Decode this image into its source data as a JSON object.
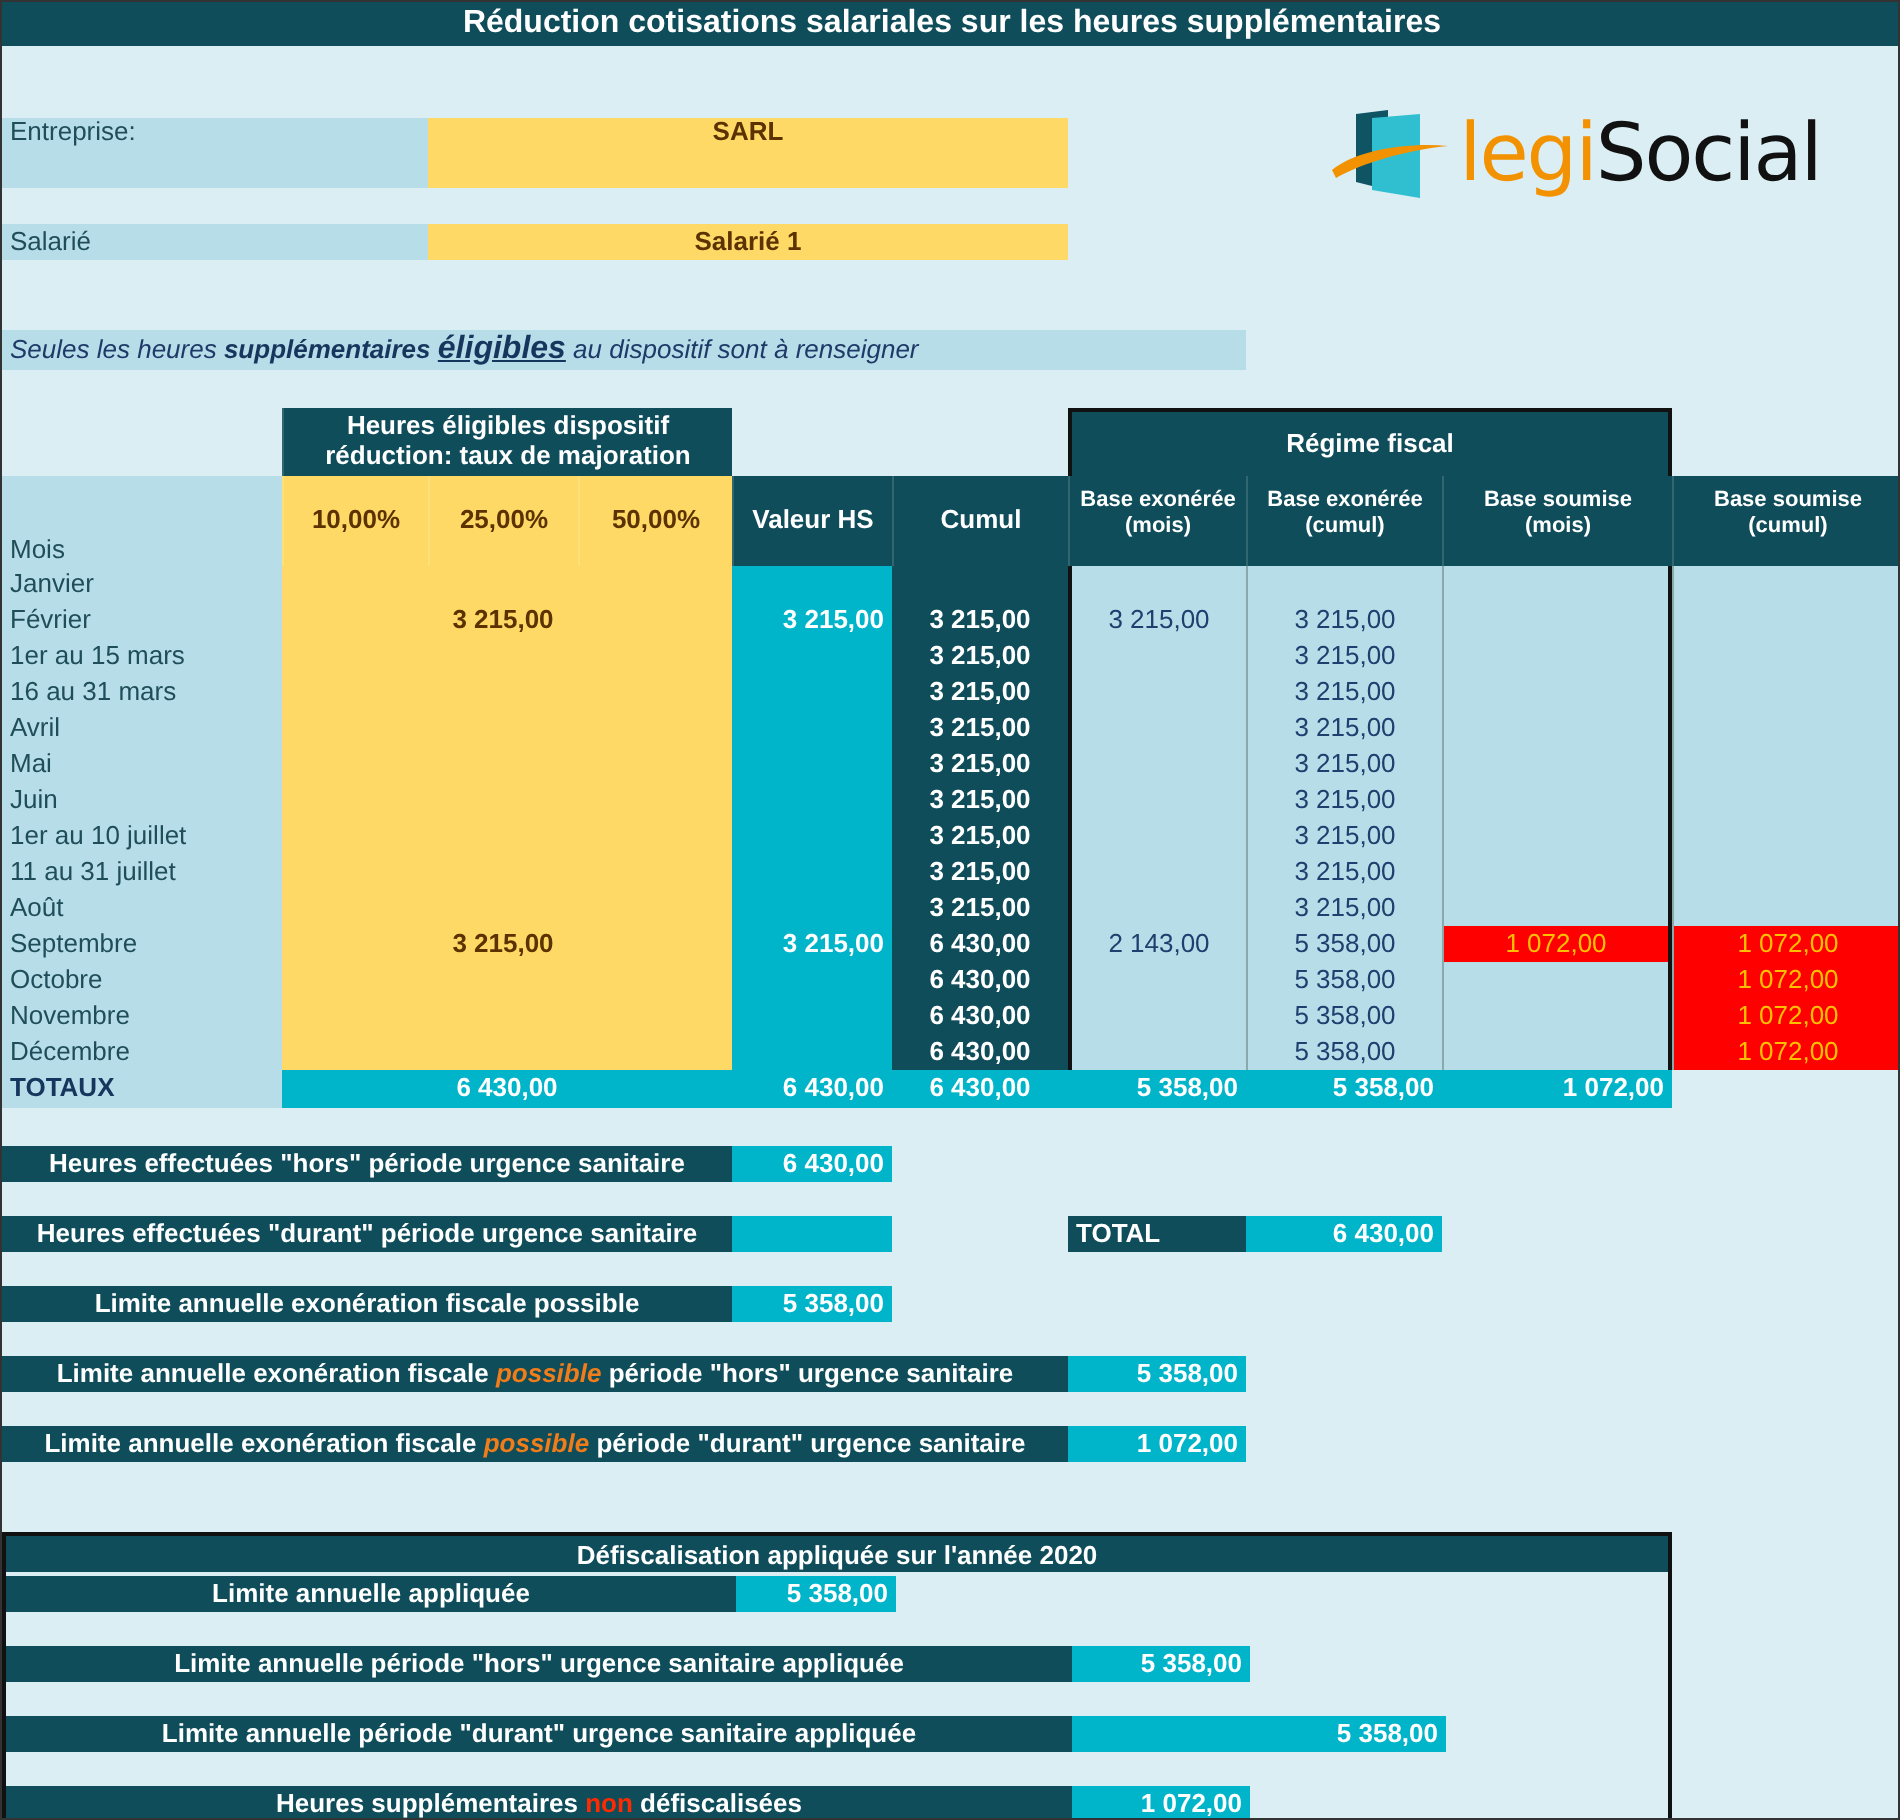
{
  "title": "Réduction cotisations salariales sur les heures supplémentaires",
  "company": {
    "label": "Entreprise:",
    "value": "SARL"
  },
  "employee": {
    "label": "Salarié",
    "value": "Salarié 1"
  },
  "logo": {
    "first": "legi",
    "second": "Social"
  },
  "notice": "Seules les heures **supplémentaires** *éligibles* au dispositif sont à renseigner",
  "table": {
    "group_header": "Heures éligibles dispositif réduction: taux de majoration",
    "fiscal_header": "Régime fiscal",
    "first_column": "Mois",
    "columns": [
      {
        "label": "10,00%",
        "kind": "rate"
      },
      {
        "label": "25,00%",
        "kind": "rate"
      },
      {
        "label": "50,00%",
        "kind": "rate"
      },
      {
        "label": "Valeur HS",
        "kind": "value"
      },
      {
        "label": "Cumul",
        "kind": "cumul"
      },
      {
        "label": "Base exonérée (mois)",
        "kind": "exempt"
      },
      {
        "label": "Base exonérée (cumul)",
        "kind": "exempt"
      },
      {
        "label": "Base soumise (mois)",
        "kind": "subject"
      },
      {
        "label": "Base soumise (cumul)",
        "kind": "subject"
      }
    ],
    "rows": [
      {
        "label": "Janvier",
        "cells": [
          null,
          null,
          null,
          null,
          null,
          null,
          null,
          null,
          null
        ]
      },
      {
        "label": "Février",
        "cells": [
          null,
          "3 215,00",
          null,
          "3 215,00",
          "3 215,00",
          "3 215,00",
          "3 215,00",
          null,
          null
        ]
      },
      {
        "label": "1er au 15 mars",
        "cells": [
          null,
          null,
          null,
          null,
          "3 215,00",
          null,
          "3 215,00",
          null,
          null
        ]
      },
      {
        "label": "16 au 31 mars",
        "cells": [
          null,
          null,
          null,
          null,
          "3 215,00",
          null,
          "3 215,00",
          null,
          null
        ]
      },
      {
        "label": "Avril",
        "cells": [
          null,
          null,
          null,
          null,
          "3 215,00",
          null,
          "3 215,00",
          null,
          null
        ]
      },
      {
        "label": "Mai",
        "cells": [
          null,
          null,
          null,
          null,
          "3 215,00",
          null,
          "3 215,00",
          null,
          null
        ]
      },
      {
        "label": "Juin",
        "cells": [
          null,
          null,
          null,
          null,
          "3 215,00",
          null,
          "3 215,00",
          null,
          null
        ]
      },
      {
        "label": "1er au 10 juillet",
        "cells": [
          null,
          null,
          null,
          null,
          "3 215,00",
          null,
          "3 215,00",
          null,
          null
        ]
      },
      {
        "label": "11 au 31 juillet",
        "cells": [
          null,
          null,
          null,
          null,
          "3 215,00",
          null,
          "3 215,00",
          null,
          null
        ]
      },
      {
        "label": "Août",
        "cells": [
          null,
          null,
          null,
          null,
          "3 215,00",
          null,
          "3 215,00",
          null,
          null
        ]
      },
      {
        "label": "Septembre",
        "cells": [
          null,
          "3 215,00",
          null,
          "3 215,00",
          "6 430,00",
          "2 143,00",
          "5 358,00",
          "1 072,00",
          "1 072,00"
        ]
      },
      {
        "label": "Octobre",
        "cells": [
          null,
          null,
          null,
          null,
          "6 430,00",
          null,
          "5 358,00",
          null,
          "1 072,00"
        ]
      },
      {
        "label": "Novembre",
        "cells": [
          null,
          null,
          null,
          null,
          "6 430,00",
          null,
          "5 358,00",
          null,
          "1 072,00"
        ]
      },
      {
        "label": "Décembre",
        "cells": [
          null,
          null,
          null,
          null,
          "6 430,00",
          null,
          "5 358,00",
          null,
          "1 072,00"
        ]
      }
    ],
    "totals": {
      "label": "TOTAUX",
      "rates": "6 430,00",
      "values": [
        "6 430,00",
        "6 430,00",
        "5 358,00",
        "5 358,00",
        "1 072,00"
      ]
    }
  },
  "summary": [
    {
      "kind": "short",
      "label": "Heures effectuées \"hors\" période urgence sanitaire",
      "value": "6 430,00"
    },
    {
      "kind": "short",
      "label": "Heures effectuées \"durant\" période urgence sanitaire",
      "total": {
        "label": "TOTAL",
        "value": "6 430,00"
      }
    },
    {
      "kind": "short",
      "label": "Limite annuelle exonération fiscale possible",
      "value": "5 358,00"
    },
    {
      "kind": "long",
      "label": "Limite annuelle exonération fiscale *possible* période \"hors\" urgence sanitaire",
      "value": "5 358,00"
    },
    {
      "kind": "long",
      "label": "Limite annuelle exonération fiscale *possible* période \"durant\" urgence sanitaire",
      "value": "1 072,00"
    }
  ],
  "applied": {
    "title": "Défiscalisation appliquée sur l'année 2020",
    "rows": [
      {
        "kind": "short",
        "label": "Limite annuelle appliquée",
        "value": "5 358,00"
      },
      {
        "kind": "long",
        "label": "Limite annuelle période \"hors\" urgence sanitaire appliquée",
        "value": "5 358,00"
      },
      {
        "kind": "wide",
        "label": "Limite annuelle période \"durant\" urgence sanitaire appliquée",
        "value": "5 358,00"
      },
      {
        "kind": "long",
        "label": "Heures supplémentaires **non** défiscalisées",
        "value": "1 072,00"
      }
    ]
  }
}
